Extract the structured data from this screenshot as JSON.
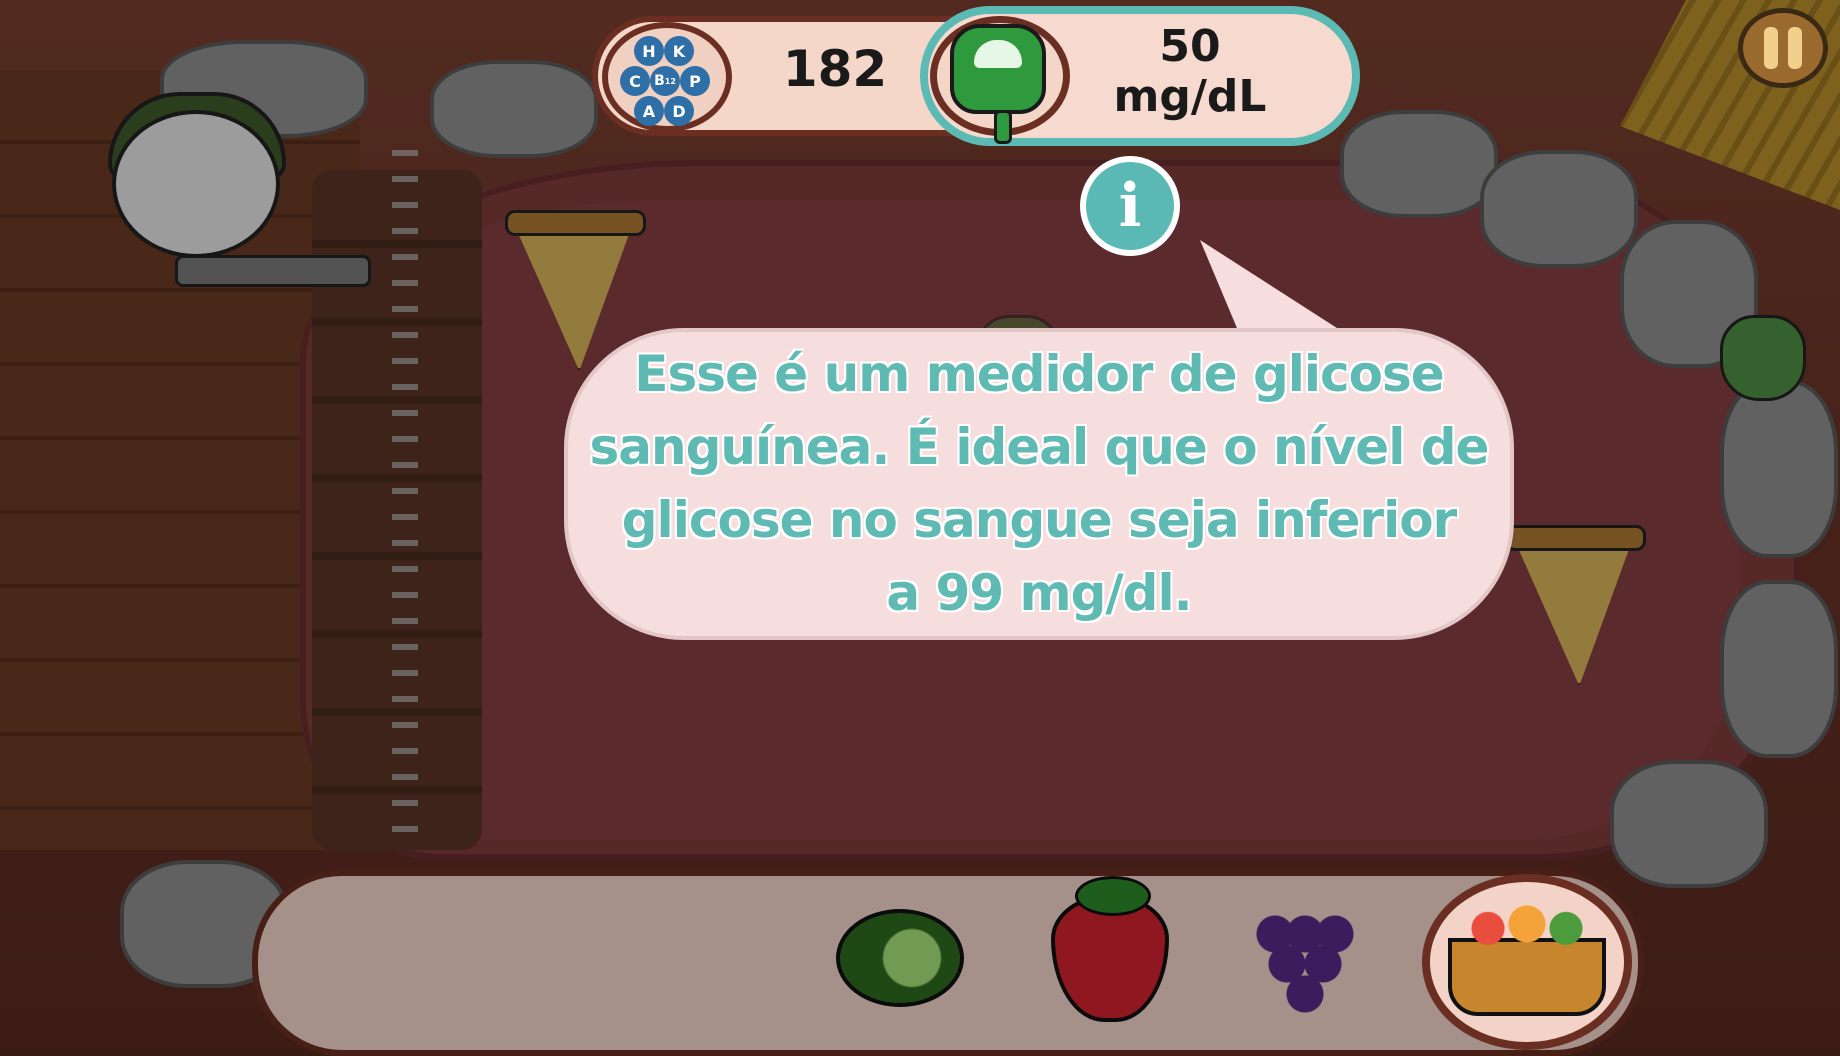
{
  "hud": {
    "vitamins": [
      "H",
      "K",
      "C",
      "B",
      "P",
      "A",
      "D"
    ],
    "vitamin_subscript": "12",
    "score": "182",
    "glucose_value": "50",
    "glucose_unit": "mg/dL"
  },
  "tutorial": {
    "info_glyph": "i",
    "line1": "Esse é um medidor de glicose",
    "line2": "sanguínea. É ideal que o nível de",
    "line3": "glicose no sangue seja inferior",
    "line4": "a 99 mg/dl."
  },
  "inventory": {
    "items": [
      "cucumber-icon",
      "strawberry-icon",
      "grapes-icon"
    ],
    "basket": "basket-icon"
  },
  "colors": {
    "accent": "#5ebab3",
    "hud_border": "#6a2f22",
    "arena": "#7f3b3c"
  }
}
